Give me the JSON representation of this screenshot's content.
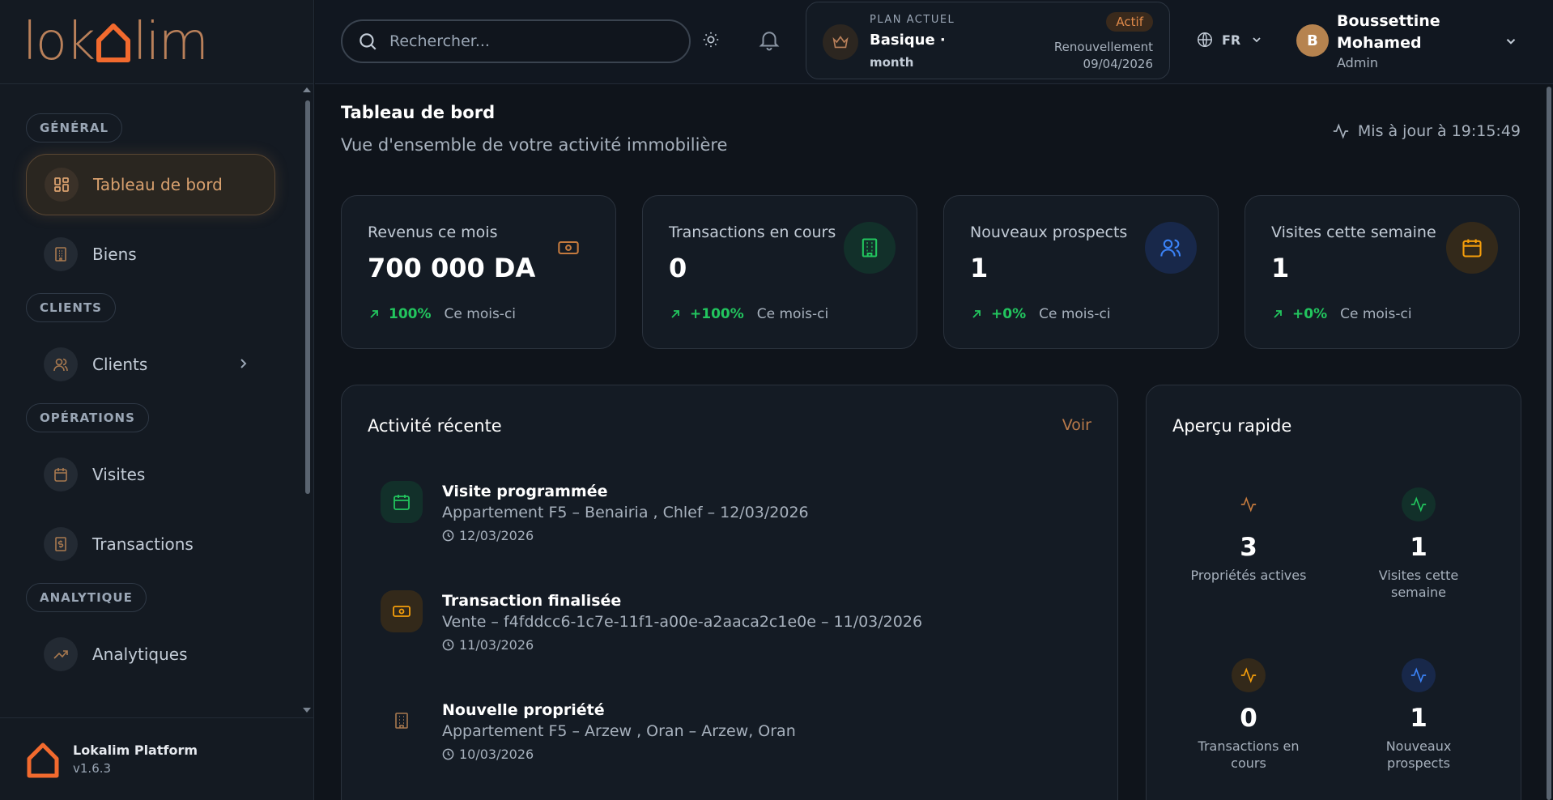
{
  "app": {
    "logo_text_left": "lok",
    "logo_text_right": "lim",
    "brand_color": "#b9805a",
    "accent_color": "#f26a2e"
  },
  "search": {
    "placeholder": "Rechercher..."
  },
  "plan": {
    "label": "PLAN ACTUEL",
    "name": "Basique ·",
    "period": "month",
    "status": "Actif",
    "renew_label": "Renouvellement",
    "renew_date": "09/04/2026"
  },
  "language": {
    "code": "FR"
  },
  "user": {
    "initial": "B",
    "name": "Boussettine Mohamed",
    "role": "Admin"
  },
  "sidebar": {
    "sections": [
      {
        "label": "GÉNÉRAL",
        "items": [
          {
            "label": "Tableau de bord",
            "icon": "dashboard-icon",
            "active": true
          },
          {
            "label": "Biens",
            "icon": "building-icon"
          }
        ]
      },
      {
        "label": "CLIENTS",
        "items": [
          {
            "label": "Clients",
            "icon": "users-icon",
            "has_submenu": true
          }
        ]
      },
      {
        "label": "OPÉRATIONS",
        "items": [
          {
            "label": "Visites",
            "icon": "calendar-icon"
          },
          {
            "label": "Transactions",
            "icon": "receipt-icon"
          }
        ]
      },
      {
        "label": "ANALYTIQUE",
        "items": [
          {
            "label": "Analytiques",
            "icon": "trending-up-icon"
          }
        ]
      }
    ]
  },
  "platform": {
    "name": "Lokalim Platform",
    "version": "v1.6.3"
  },
  "page": {
    "title": "Tableau de bord",
    "subtitle": "Vue d'ensemble de votre activité immobilière",
    "updated": "Mis à jour à 19:15:49"
  },
  "kpis": [
    {
      "label": "Revenus ce mois",
      "value": "700 000 DA",
      "trend": "100%",
      "period": "Ce mois-ci",
      "icon": "banknote-icon",
      "color": "#c47a3e"
    },
    {
      "label": "Transactions en cours",
      "value": "0",
      "trend": "+100%",
      "period": "Ce mois-ci",
      "icon": "building-icon",
      "color": "#22c55e"
    },
    {
      "label": "Nouveaux prospects",
      "value": "1",
      "trend": "+0%",
      "period": "Ce mois-ci",
      "icon": "users-icon",
      "color": "#3b82f6"
    },
    {
      "label": "Visites cette semaine",
      "value": "1",
      "trend": "+0%",
      "period": "Ce mois-ci",
      "icon": "calendar-icon",
      "color": "#f59e0b"
    }
  ],
  "activity": {
    "title": "Activité récente",
    "link": "Voir",
    "items": [
      {
        "title": "Visite programmée",
        "desc": "Appartement F5 – Benairia , Chlef – 12/03/2026",
        "date": "12/03/2026",
        "icon": "calendar-icon"
      },
      {
        "title": "Transaction finalisée",
        "desc": "Vente – f4fddcc6-1c7e-11f1-a00e-a2aaca2c1e0e – 11/03/2026",
        "date": "11/03/2026",
        "icon": "banknote-icon"
      },
      {
        "title": "Nouvelle propriété",
        "desc": "Appartement F5 – Arzew , Oran – Arzew, Oran",
        "date": "10/03/2026",
        "icon": "building-icon"
      }
    ]
  },
  "quick": {
    "title": "Aperçu rapide",
    "items": [
      {
        "value": "3",
        "label": "Propriétés actives",
        "color": "#c47a3e"
      },
      {
        "value": "1",
        "label": "Visites cette semaine",
        "color": "#22c55e"
      },
      {
        "value": "0",
        "label": "Transactions en cours",
        "color": "#f59e0b"
      },
      {
        "value": "1",
        "label": "Nouveaux prospects",
        "color": "#3b82f6"
      }
    ]
  }
}
